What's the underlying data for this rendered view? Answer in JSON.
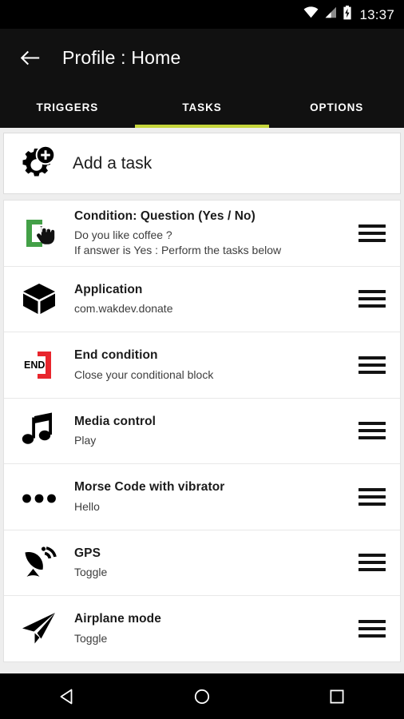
{
  "statusbar": {
    "time": "13:37",
    "icons": [
      "wifi-icon",
      "cellular-signal-icon",
      "battery-charging-icon"
    ]
  },
  "appbar": {
    "back_icon": "arrow-back-icon",
    "title": "Profile : Home"
  },
  "tabs": {
    "active_index": 1,
    "accent_color": "#c6d63c",
    "items": [
      {
        "label": "TRIGGERS"
      },
      {
        "label": "TASKS"
      },
      {
        "label": "OPTIONS"
      }
    ]
  },
  "add_task": {
    "icon": "gear-plus-icon",
    "label": "Add a task"
  },
  "tasks": [
    {
      "icon": "condition-bracket-hand-icon",
      "icon_color": "#43a047",
      "title": "Condition: Question (Yes / No)",
      "subtitle": "Do you like coffee ?\nIf answer is Yes : Perform the tasks below",
      "handle": "drag-handle-icon"
    },
    {
      "icon": "cube-box-icon",
      "icon_color": "#000000",
      "title": "Application",
      "subtitle": "com.wakdev.donate",
      "handle": "drag-handle-icon"
    },
    {
      "icon": "end-bracket-icon",
      "icon_color": "#e8262d",
      "title": "End condition",
      "subtitle": "Close your conditional block",
      "icon_text": "END",
      "handle": "drag-handle-icon"
    },
    {
      "icon": "music-note-icon",
      "icon_color": "#000000",
      "title": "Media control",
      "subtitle": "Play",
      "handle": "drag-handle-icon"
    },
    {
      "icon": "three-dots-icon",
      "icon_color": "#000000",
      "title": "Morse Code with vibrator",
      "subtitle": "Hello",
      "handle": "drag-handle-icon"
    },
    {
      "icon": "satellite-dish-icon",
      "icon_color": "#000000",
      "title": "GPS",
      "subtitle": "Toggle",
      "handle": "drag-handle-icon"
    },
    {
      "icon": "paper-plane-icon",
      "icon_color": "#000000",
      "title": "Airplane mode",
      "subtitle": "Toggle",
      "handle": "drag-handle-icon"
    }
  ],
  "navbar": {
    "back": "nav-back-triangle-icon",
    "home": "nav-home-circle-icon",
    "recents": "nav-recents-square-icon"
  }
}
